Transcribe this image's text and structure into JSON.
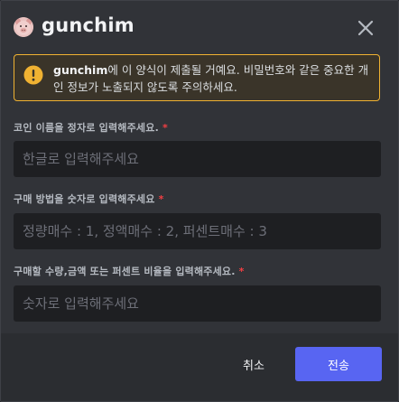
{
  "modal": {
    "title": "gunchim",
    "close_icon": "close-icon",
    "avatar_icon": "pig-avatar"
  },
  "warning": {
    "icon": "warning-icon",
    "app_name": "gunchim",
    "message": "에 이 양식이 제출될 거예요. 비밀번호와 같은 중요한 개인 정보가 노출되지 않도록 주의하세요."
  },
  "fields": [
    {
      "label": "코인 이름을 정자로 입력해주세요.",
      "required_mark": "*",
      "value": "",
      "placeholder": "한글로 입력해주세요"
    },
    {
      "label": "구매 방법을 숫자로 입력해주세요",
      "required_mark": "*",
      "value": "",
      "placeholder": "정량매수 : 1, 정액매수 : 2, 퍼센트매수 : 3"
    },
    {
      "label": "구매할 수량,금액 또는 퍼센트 비율을 입력해주세요.",
      "required_mark": "*",
      "value": "",
      "placeholder": "숫자로 입력해주세요"
    }
  ],
  "footer": {
    "cancel_label": "취소",
    "submit_label": "전송"
  },
  "colors": {
    "modal_bg": "#313338",
    "input_bg": "#1e1f22",
    "footer_bg": "#2b2d31",
    "warning_border": "#f0b232",
    "required": "#f23f43",
    "primary_button": "#5865f2"
  }
}
